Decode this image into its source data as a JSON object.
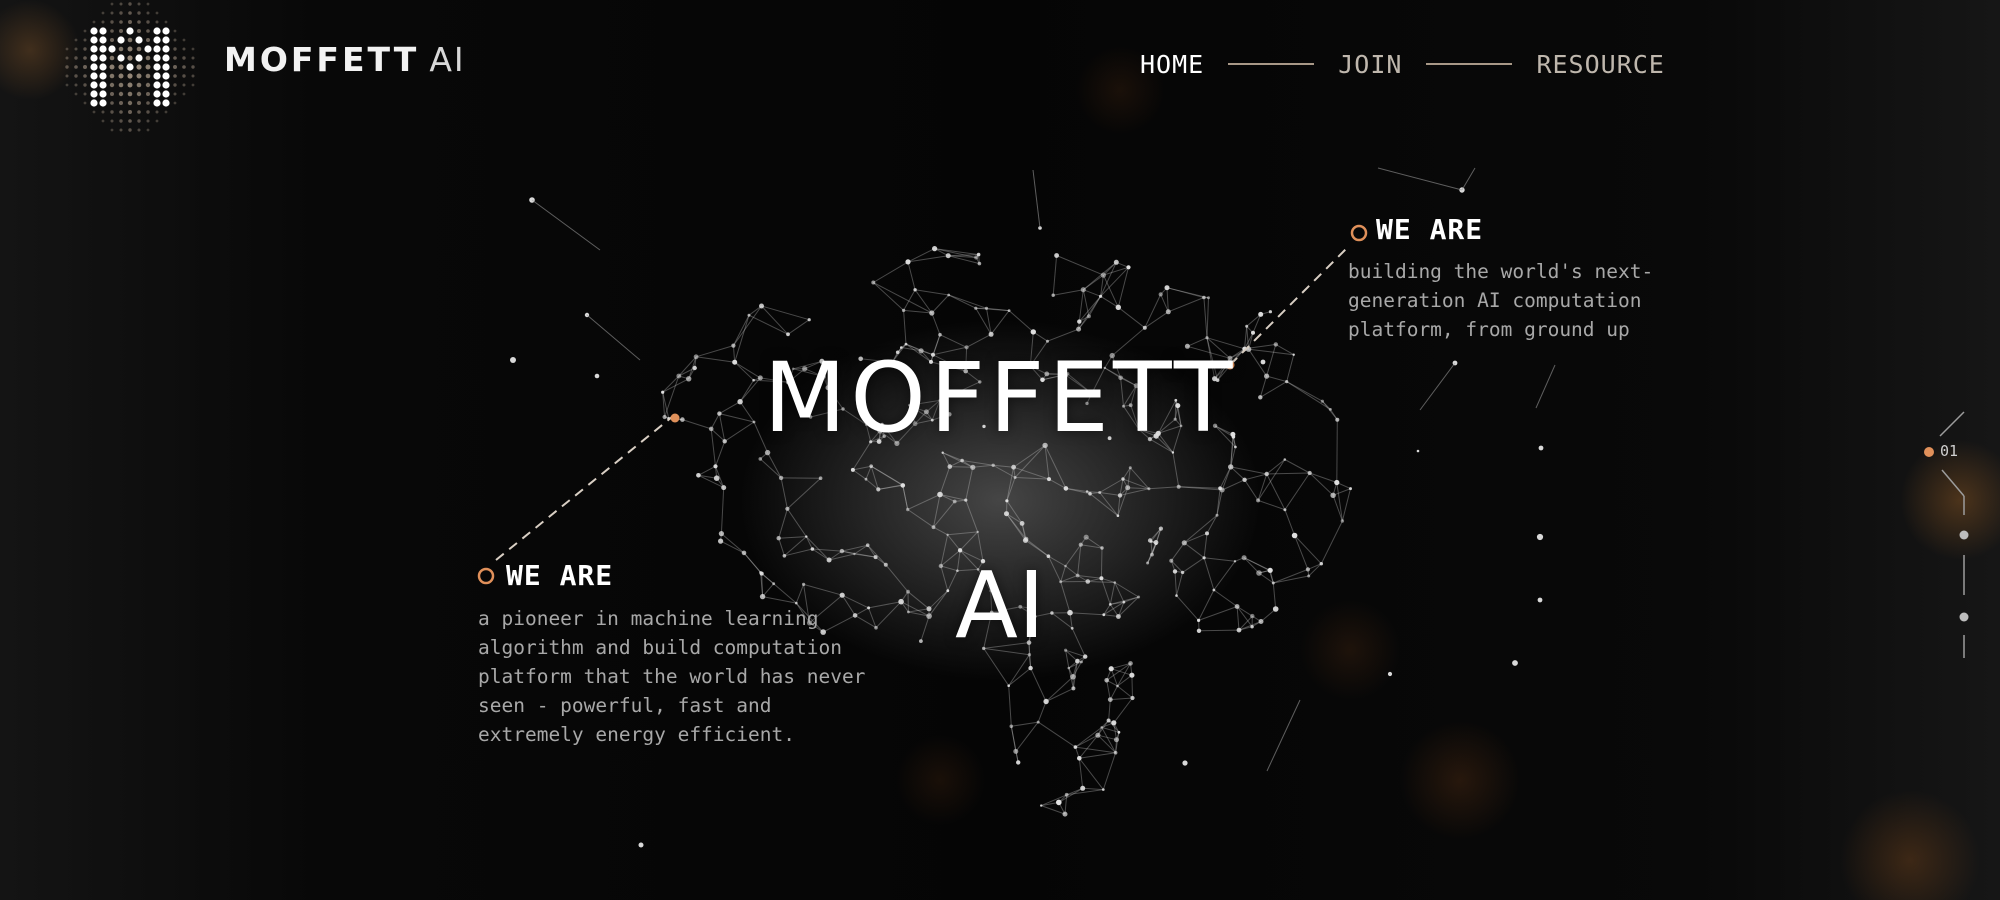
{
  "header": {
    "brand_bold": "MOFFETT",
    "brand_light": "AI",
    "logo_icon": "moffett-dot-matrix-m-logo"
  },
  "nav": {
    "items": [
      {
        "label": "HOME",
        "active": true
      },
      {
        "label": "JOIN",
        "active": false
      },
      {
        "label": "RESOURCE",
        "active": false
      }
    ]
  },
  "hero": {
    "title": "MOFFETT",
    "subtitle": "AI",
    "background_icon": "wireframe-brain-network-icon"
  },
  "callouts": {
    "left": {
      "title": "WE ARE",
      "text": "a pioneer in machine learning\nalgorithm and build computation\nplatform that the world has never\nseen - powerful, fast and\nextremely energy efficient."
    },
    "right": {
      "title": "WE ARE",
      "text": "building the world's next-\ngeneration AI computation\nplatform, from ground up"
    }
  },
  "pager": {
    "current": "01",
    "total_dots": 3,
    "active_index": 0
  },
  "colors": {
    "accent": "#e0905a",
    "background": "#060606",
    "text_primary": "#ffffff",
    "text_secondary": "#a8a8a8",
    "nav_divider": "#a89887"
  }
}
